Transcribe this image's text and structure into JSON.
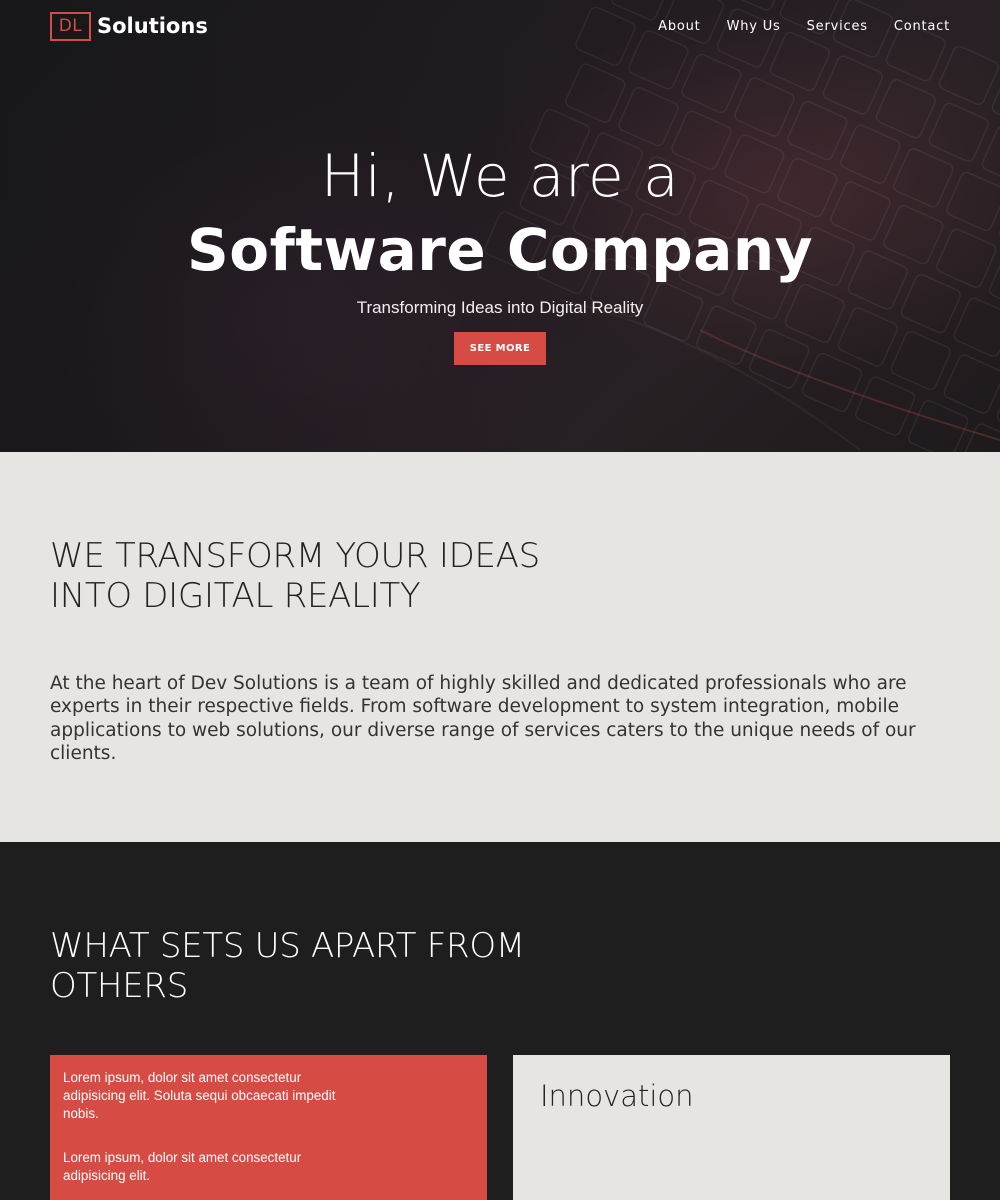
{
  "brand": {
    "mark": "DL",
    "name": "Solutions",
    "accent": "#d64b43"
  },
  "nav": {
    "items": [
      {
        "label": "About"
      },
      {
        "label": "Why Us"
      },
      {
        "label": "Services"
      },
      {
        "label": "Contact"
      }
    ]
  },
  "hero": {
    "line1": "Hi, We are a",
    "line2": "Software Company",
    "tagline": "Transforming Ideas into Digital Reality",
    "button": "SEE MORE"
  },
  "transform": {
    "title_line1": "WE TRANSFORM YOUR IDEAS",
    "title_line2": "INTO DIGITAL REALITY",
    "body": "At the heart of Dev Solutions is a team of highly skilled and dedicated professionals who are experts in their respective fields. From software development to system integration, mobile applications to web solutions, our diverse range of services caters to the unique needs of our clients."
  },
  "apart": {
    "title_line1": "WHAT SETS US APART FROM",
    "title_line2": "OTHERS",
    "card_red": {
      "p1": "Lorem ipsum, dolor sit amet consectetur adipisicing elit. Soluta sequi obcaecati impedit nobis.",
      "p2": "Lorem ipsum, dolor sit amet consectetur adipisicing elit."
    },
    "card_light": {
      "title": "Innovation"
    }
  },
  "colors": {
    "dark": "#1e1e1f",
    "light": "#e6e5e1",
    "accent": "#d64b43"
  }
}
